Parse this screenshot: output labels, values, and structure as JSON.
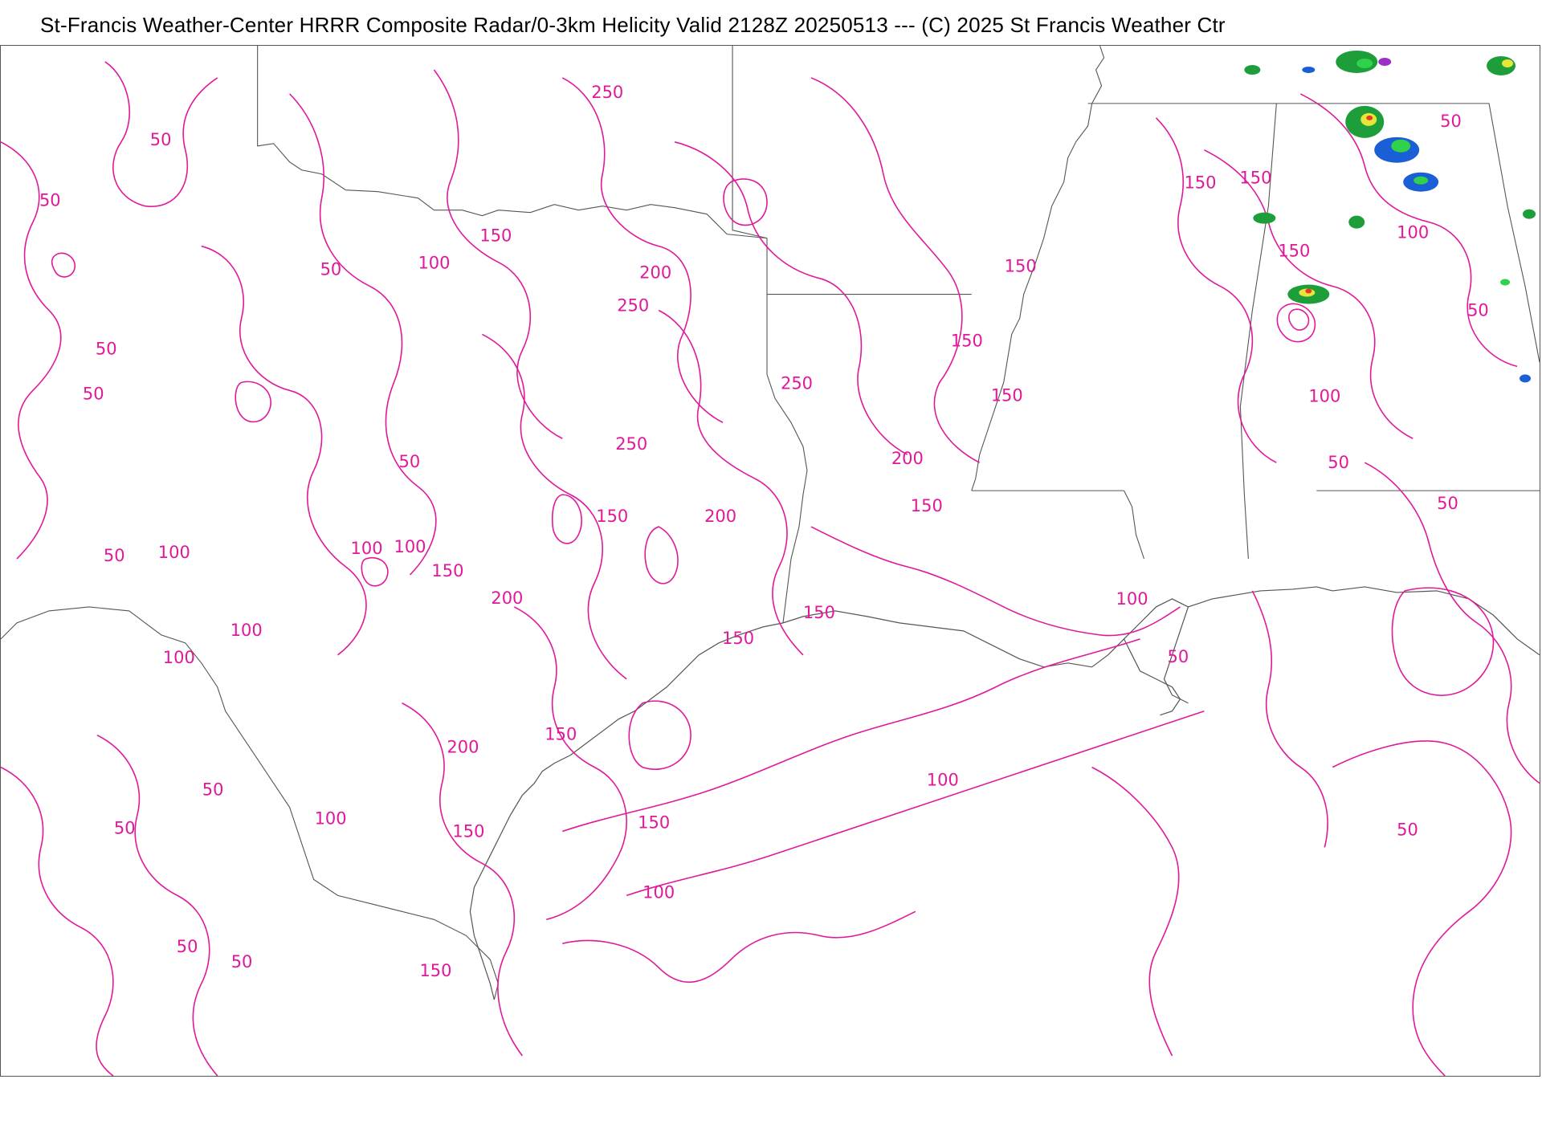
{
  "header": {
    "title": "St-Francis Weather-Center HRRR Composite Radar/0-3km Helicity  Valid  2128Z 20250513  --- (C) 2025 St Francis Weather Ctr"
  },
  "map": {
    "contour_color": "#e0199b",
    "border_color": "#555555",
    "background": "#ffffff",
    "radar_colors": [
      "#1e9e3a",
      "#2fd24a",
      "#1b5fd6",
      "#e6e63a",
      "#e53a2a",
      "#9b2fc8"
    ],
    "contour_labels": [
      {
        "text": "50",
        "region": "upper-left"
      },
      {
        "text": "50",
        "region": "upper-left"
      },
      {
        "text": "250",
        "region": "top-center"
      },
      {
        "text": "150",
        "region": "top-center"
      },
      {
        "text": "50",
        "region": "upper-left"
      },
      {
        "text": "100",
        "region": "top-center"
      },
      {
        "text": "200",
        "region": "top-center"
      },
      {
        "text": "250",
        "region": "top-center"
      },
      {
        "text": "50",
        "region": "left"
      },
      {
        "text": "50",
        "region": "left"
      },
      {
        "text": "250",
        "region": "center"
      },
      {
        "text": "250",
        "region": "center"
      },
      {
        "text": "50",
        "region": "left"
      },
      {
        "text": "150",
        "region": "center"
      },
      {
        "text": "200",
        "region": "center"
      },
      {
        "text": "50",
        "region": "left"
      },
      {
        "text": "100",
        "region": "left"
      },
      {
        "text": "100",
        "region": "left"
      },
      {
        "text": "100",
        "region": "left"
      },
      {
        "text": "150",
        "region": "center"
      },
      {
        "text": "200",
        "region": "center"
      },
      {
        "text": "100",
        "region": "left"
      },
      {
        "text": "100",
        "region": "left"
      },
      {
        "text": "150",
        "region": "center"
      },
      {
        "text": "150",
        "region": "center"
      },
      {
        "text": "200",
        "region": "center"
      },
      {
        "text": "150",
        "region": "center"
      },
      {
        "text": "50",
        "region": "lower-left"
      },
      {
        "text": "100",
        "region": "lower-left"
      },
      {
        "text": "50",
        "region": "lower-left"
      },
      {
        "text": "150",
        "region": "lower-center"
      },
      {
        "text": "100",
        "region": "lower-center"
      },
      {
        "text": "50",
        "region": "lower-left"
      },
      {
        "text": "50",
        "region": "lower-left"
      },
      {
        "text": "150",
        "region": "lower-center"
      },
      {
        "text": "150",
        "region": "lower-center"
      },
      {
        "text": "100",
        "region": "lower-center"
      },
      {
        "text": "200",
        "region": "center-right"
      },
      {
        "text": "150",
        "region": "center-right"
      },
      {
        "text": "150",
        "region": "right"
      },
      {
        "text": "150",
        "region": "right"
      },
      {
        "text": "150",
        "region": "right"
      },
      {
        "text": "100",
        "region": "right"
      },
      {
        "text": "50",
        "region": "right"
      },
      {
        "text": "150",
        "region": "upper-right"
      },
      {
        "text": "150",
        "region": "upper-right"
      },
      {
        "text": "150",
        "region": "upper-right"
      },
      {
        "text": "100",
        "region": "upper-right"
      },
      {
        "text": "50",
        "region": "upper-right"
      },
      {
        "text": "50",
        "region": "upper-right"
      },
      {
        "text": "100",
        "region": "right"
      },
      {
        "text": "50",
        "region": "right"
      },
      {
        "text": "50",
        "region": "right"
      },
      {
        "text": "50",
        "region": "lower-right"
      }
    ]
  }
}
